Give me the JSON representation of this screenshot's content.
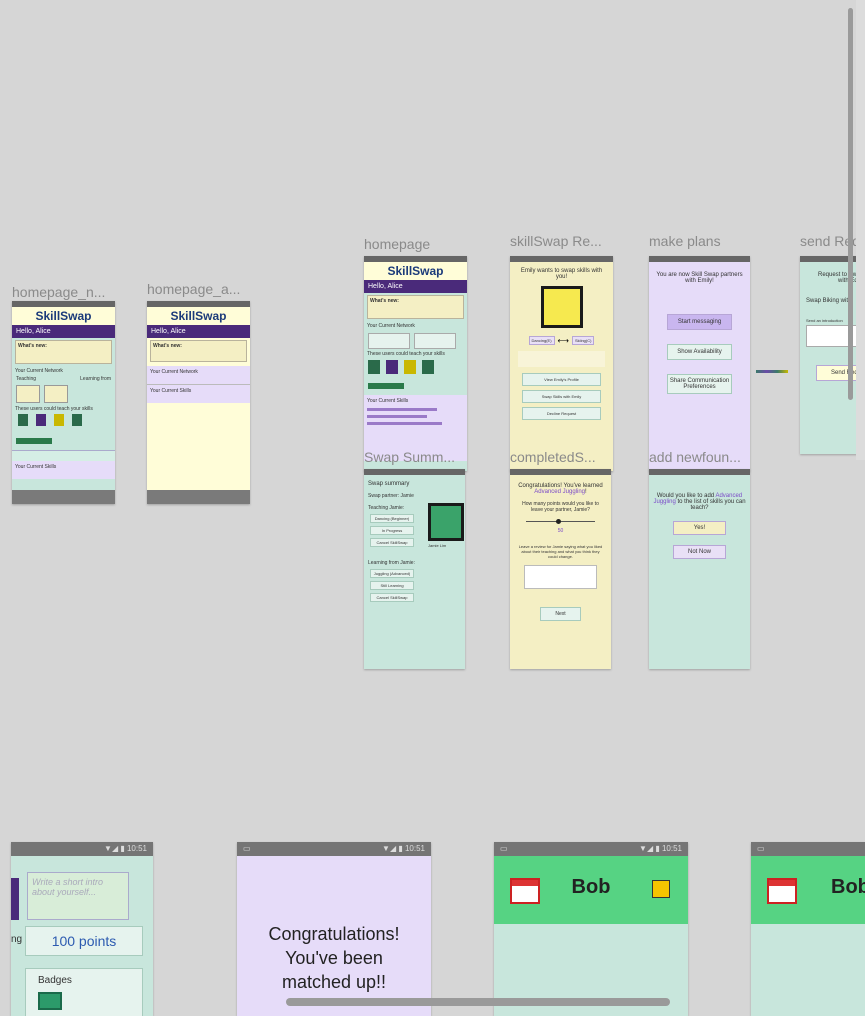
{
  "labels": {
    "homepage_n": "homepage_n...",
    "homepage_a": "homepage_a...",
    "homepage": "homepage",
    "skillswap_re": "skillSwap Re...",
    "make_plans": "make plans",
    "send_req": "send Req",
    "swap_summ": "Swap Summ...",
    "completeds": "completedS...",
    "add_newfoun": "add newfoun..."
  },
  "home": {
    "logo": "SkillSwap",
    "greeting": "Hello, Alice",
    "whats_new": "What's new:",
    "current_network": "Your Current Network",
    "current_skills": "Your Current Skills",
    "teaching": "Teaching",
    "learning": "Learning from",
    "users_can_teach": "These users could teach your skills",
    "search_btn": "Search for new skills"
  },
  "request": {
    "title": "Emily wants to swap skills with you!",
    "skill_a": "Dancing(E)",
    "skill_b": "Skiing(C)",
    "view_profile": "View Emily's Profile",
    "swap_btn": "Swap Skills with Emily",
    "decline": "Decline Request"
  },
  "plans": {
    "title": "You are now Skill Swap partners with Emily!",
    "start_msg": "Start messaging",
    "show_avail": "Show Availability",
    "share_pref": "Share Communication Preferences"
  },
  "sendreq": {
    "line1": "Request to Swap",
    "line2": "with Ed",
    "swap": "Swap Biking with",
    "intro": "Send an introduction",
    "send_btn": "Send Req"
  },
  "summary": {
    "title": "Swap summary",
    "partner": "Swap partner: Jamie",
    "teaching": "Teaching Jamie:",
    "skill1": "Dancing (Beginner)",
    "skill1_status": "In Progress",
    "cancel1": "Cancel SkillSwap",
    "learning": "Learning from Jamie:",
    "skill2": "Juggling (Advanced)",
    "skill2_status": "Still Learning",
    "cancel2": "Cancel SkillSwap",
    "avatar_name": "Jamie Lim"
  },
  "completed": {
    "title_a": "Congratulations! You've learned ",
    "title_skill": "Advanced Juggling",
    "title_b": "!",
    "question": "How many points would you like to leave your partner, Jamie?",
    "value": "50",
    "note": "Leave a review for Jamie saying what you liked about their teaching and what you think they could change.",
    "next": "Next"
  },
  "addnew": {
    "q_a": "Would you like to add ",
    "q_skill": "Advanced Juggling",
    "q_b": " to the list of skills you can teach?",
    "yes": "Yes!",
    "no": "Not Now"
  },
  "bottom": {
    "time": "10:51",
    "about_placeholder": "Write a short intro about yourself...",
    "points": "100 points",
    "badges": "Badges",
    "side_text": "ng",
    "congrats": "Congratulations! You've been matched up!!",
    "bob": "Bob",
    "bob2": "Bob"
  },
  "colors": {
    "canvas": "#d6d6d6",
    "mint": "#c8e6dc",
    "cream": "#fffdd8",
    "lavender": "#e6dcf9",
    "yellow": "#f4efc4",
    "purple": "#4a2a7a",
    "green_header": "#56d383"
  }
}
